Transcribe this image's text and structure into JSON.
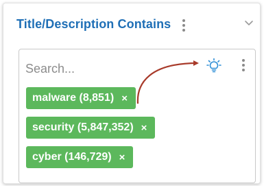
{
  "panel": {
    "title": "Title/Description Contains"
  },
  "search": {
    "placeholder": "Search..."
  },
  "tags": [
    {
      "label": "malware (8,851)",
      "remove": "×"
    },
    {
      "label": "security (5,847,352)",
      "remove": "×"
    },
    {
      "label": "cyber (146,729)",
      "remove": "×"
    }
  ],
  "icons": {
    "title_menu": "kebab-menu-icon",
    "collapse": "chevron-down-icon",
    "suggest": "lightbulb-icon",
    "box_menu": "kebab-menu-icon"
  },
  "colors": {
    "title": "#1f6fb6",
    "tag_bg": "#5cb85c",
    "bulb": "#2d8ed6",
    "arrow": "#a83a2a"
  }
}
